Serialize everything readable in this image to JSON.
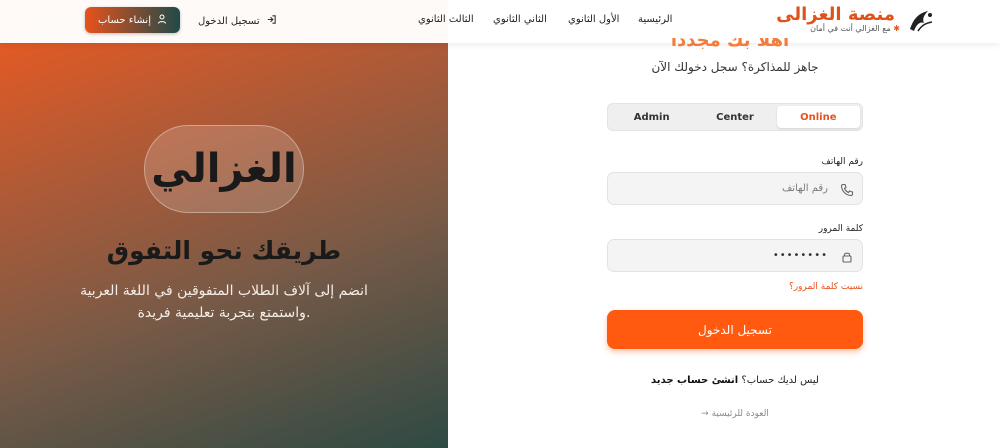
{
  "nav": {
    "brand_name": "منصة الغزالى",
    "brand_tagline": "مع الغزالي أنت في أمان",
    "links": [
      "الرئيسية",
      "الأول الثانوي",
      "الثاني الثانوي",
      "الثالث الثانوي"
    ],
    "login_label": "تسجيل الدخول",
    "signup_label": "إنشاء حساب"
  },
  "hero": {
    "logo_text": "الغزالي",
    "title": "طريقك نحو التفوق",
    "description": "انضم إلى آلاف الطلاب المتفوقين في اللغة العربية واستمتع بتجربة تعليمية فريدة."
  },
  "form": {
    "welcome_title": "أهلاً بك مجدداً",
    "subtitle": "جاهز للمذاكرة؟ سجل دخولك الآن",
    "role_tabs": [
      "Admin",
      "Center",
      "Online"
    ],
    "active_role": "Online",
    "phone_label": "رقم الهاتف",
    "phone_placeholder": "رقم الهاتف",
    "password_label": "كلمة المرور",
    "password_value": "••••••••",
    "forgot_label": "نسيت كلمة المرور؟",
    "submit_label": "تسجيل الدخول",
    "no_account_text": "ليس لديك حساب؟",
    "create_account_link": "انشئ حساب جديد",
    "back_home": "العودة للرئيسية"
  },
  "colors": {
    "accent": "#ff5a0f",
    "brand": "#e0521a",
    "gradient_start": "#f15a1f",
    "gradient_end": "#2e4a44"
  },
  "icons": [
    "brand-logo-icon",
    "login-arrow-icon",
    "user-icon",
    "phone-icon",
    "lock-icon",
    "arrow-right-icon"
  ]
}
